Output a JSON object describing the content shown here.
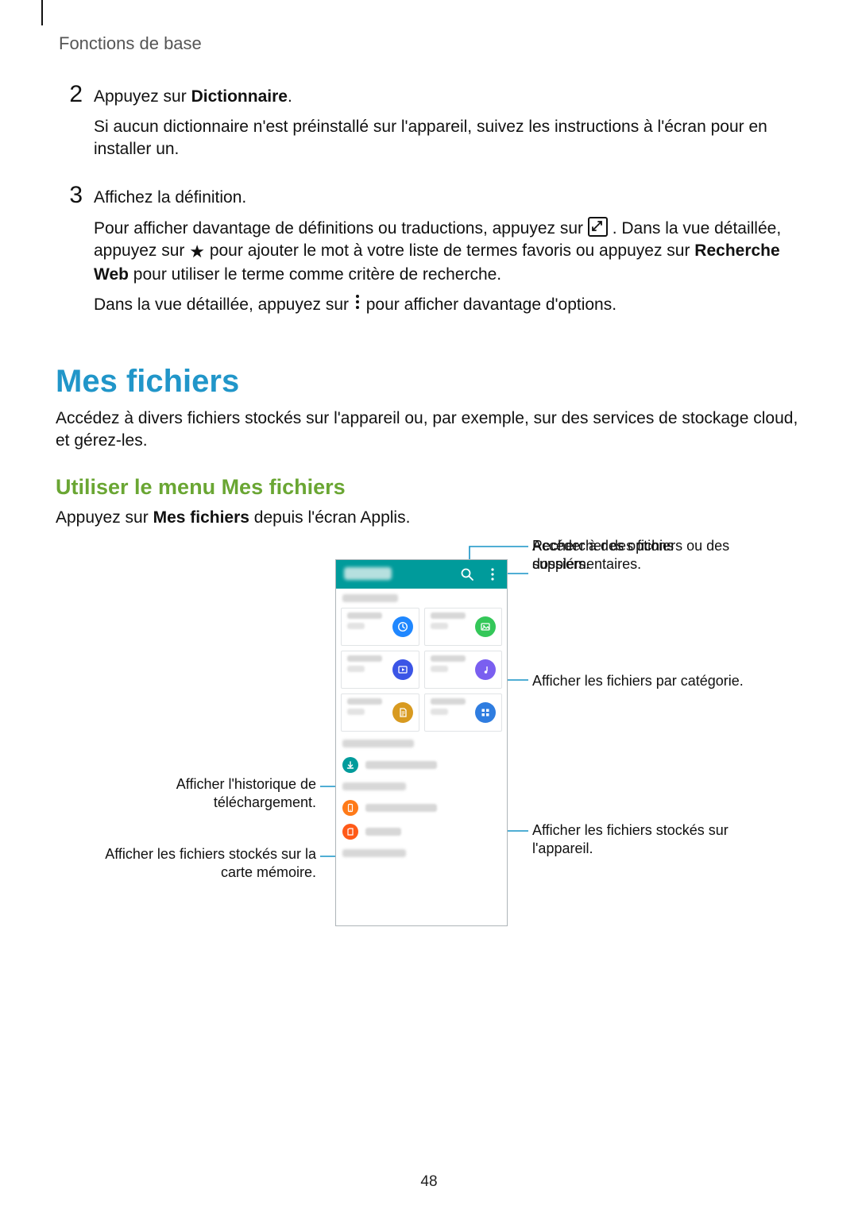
{
  "header": {
    "breadcrumb": "Fonctions de base"
  },
  "steps": {
    "s2": {
      "num": "2",
      "line1_pre": "Appuyez sur ",
      "line1_bold": "Dictionnaire",
      "line1_post": ".",
      "para": "Si aucun dictionnaire n'est préinstallé sur l'appareil, suivez les instructions à l'écran pour en installer un."
    },
    "s3": {
      "num": "3",
      "line1": "Affichez la définition.",
      "p2_a": "Pour afficher davantage de définitions ou traductions, appuyez sur ",
      "p2_b": ". Dans la vue détaillée, appuyez sur ",
      "p2_c": " pour ajouter le mot à votre liste de termes favoris ou appuyez sur ",
      "p2_bold": "Recherche Web",
      "p2_d": " pour utiliser le terme comme critère de recherche.",
      "p3_a": "Dans la vue détaillée, appuyez sur ",
      "p3_b": " pour afficher davantage d'options."
    }
  },
  "section": {
    "h1": "Mes fichiers",
    "intro": "Accédez à divers fichiers stockés sur l'appareil ou, par exemple, sur des services de stockage cloud, et gérez-les.",
    "h2": "Utiliser le menu Mes fichiers",
    "sub_pre": "Appuyez sur ",
    "sub_bold": "Mes fichiers",
    "sub_post": " depuis l'écran Applis."
  },
  "callouts": {
    "search": "Rechercher des fichiers ou des dossiers.",
    "more": "Accéder à des options supplémentaires.",
    "category": "Afficher les fichiers par catégorie.",
    "history_l1": "Afficher l'historique de",
    "history_l2": "téléchargement.",
    "sd_l1": "Afficher les fichiers stockés sur la",
    "sd_l2": "carte mémoire.",
    "device_l1": "Afficher les fichiers stockés sur",
    "device_l2": "l'appareil."
  },
  "icons": {
    "expand": "expand-icon",
    "star": "star-icon",
    "more_dots": "more-options-icon",
    "search": "search-icon",
    "menu_more": "more-menu-icon"
  },
  "footer": {
    "page": "48"
  }
}
